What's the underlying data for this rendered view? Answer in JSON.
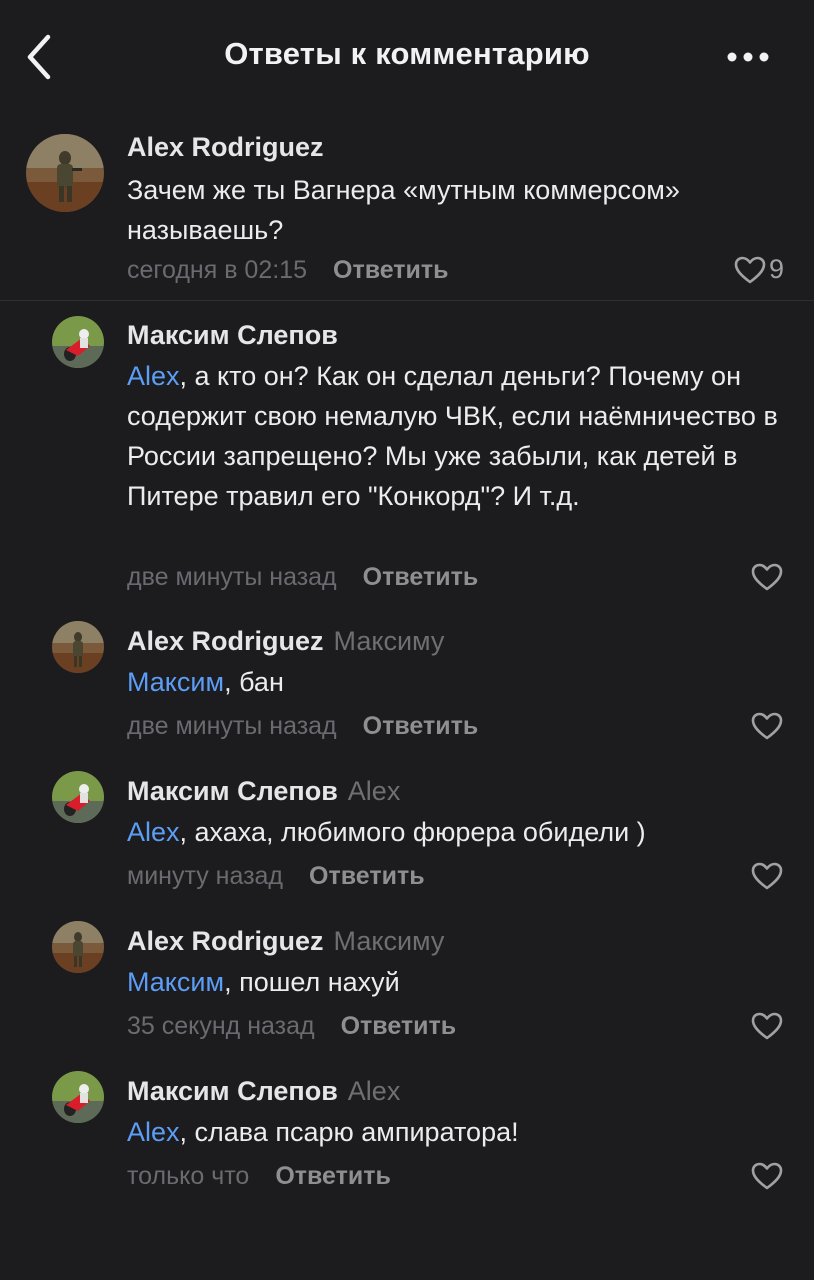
{
  "header": {
    "title": "Ответы к комментарию",
    "back_icon": "chevron-left-icon",
    "more_icon": "ellipsis-icon"
  },
  "colors": {
    "background": "#1c1c1e",
    "mention": "#5c9df6",
    "secondary_text": "#6e6e73",
    "reply_button": "#8e8e93"
  },
  "parent_comment": {
    "author": "Alex Rodriguez",
    "text": "Зачем же ты Вагнера «мутным коммерсом» называешь?",
    "time": "сегодня в 02:15",
    "reply_label": "Ответить",
    "likes": "9"
  },
  "replies": [
    {
      "author": "Максим Слепов",
      "reply_to": "",
      "mention": "Alex",
      "text": ", а кто он? Как он сделал деньги? Почему он содержит свою немалую ЧВК, если наёмничество в России запрещено? Мы уже забыли, как детей в Питере травил его \"Конкорд\"? И т.д.",
      "time": "две минуты назад",
      "reply_label": "Ответить"
    },
    {
      "author": "Alex Rodriguez",
      "reply_to": "Максиму",
      "mention": "Максим",
      "text": ", бан",
      "time": "две минуты назад",
      "reply_label": "Ответить"
    },
    {
      "author": "Максим Слепов",
      "reply_to": "Alex",
      "mention": "Alex",
      "text": ", ахаха, любимого фюрера обидели )",
      "time": "минуту назад",
      "reply_label": "Ответить"
    },
    {
      "author": "Alex Rodriguez",
      "reply_to": "Максиму",
      "mention": "Максим",
      "text": ", пошел нахуй",
      "time": "35 секунд назад",
      "reply_label": "Ответить"
    },
    {
      "author": "Максим Слепов",
      "reply_to": "Alex",
      "mention": "Alex",
      "text": ", слава псарю ампиратора!",
      "time": "только что",
      "reply_label": "Ответить"
    }
  ]
}
